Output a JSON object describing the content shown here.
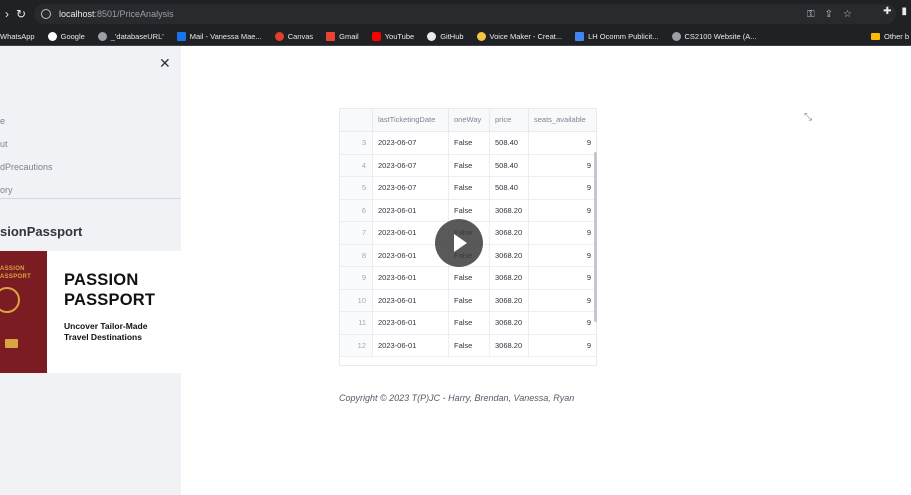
{
  "browser": {
    "url_host": "localhost",
    "url_path": ":8501/PriceAnalysis",
    "bookmarks": [
      "WhatsApp",
      "Google",
      "_'databaseURL'",
      "Mail - Vanessa Mae...",
      "Canvas",
      "Gmail",
      "YouTube",
      "GitHub",
      "Voice Maker - Creat...",
      "LH Ocomm Publicit...",
      "CS2100 Website (A..."
    ],
    "other_bookmarks": "Other b"
  },
  "sidebar": {
    "nav": [
      "e",
      "ut",
      "dPrecautions",
      "ory"
    ],
    "brand": "sionPassport",
    "logo": {
      "cover_line1": "ASSION",
      "cover_line2": "ASSPORT",
      "title1": "PASSION",
      "title2": "PASSPORT",
      "tagline1": "Uncover Tailor-Made",
      "tagline2": "Travel Destinations"
    }
  },
  "table": {
    "columns": [
      "",
      "lastTicketingDate",
      "oneWay",
      "price",
      "seats_available"
    ],
    "rows": [
      [
        "3",
        "2023-06-07",
        "False",
        "508.40",
        "9"
      ],
      [
        "4",
        "2023-06-07",
        "False",
        "508.40",
        "9"
      ],
      [
        "5",
        "2023-06-07",
        "False",
        "508.40",
        "9"
      ],
      [
        "6",
        "2023-06-01",
        "False",
        "3068.20",
        "9"
      ],
      [
        "7",
        "2023-06-01",
        "False",
        "3068.20",
        "9"
      ],
      [
        "8",
        "2023-06-01",
        "False",
        "3068.20",
        "9"
      ],
      [
        "9",
        "2023-06-01",
        "False",
        "3068.20",
        "9"
      ],
      [
        "10",
        "2023-06-01",
        "False",
        "3068.20",
        "9"
      ],
      [
        "11",
        "2023-06-01",
        "False",
        "3068.20",
        "9"
      ],
      [
        "12",
        "2023-06-01",
        "False",
        "3068.20",
        "9"
      ]
    ]
  },
  "footer": "Copyright © 2023 T(P)JC - Harry, Brendan, Vanessa, Ryan"
}
